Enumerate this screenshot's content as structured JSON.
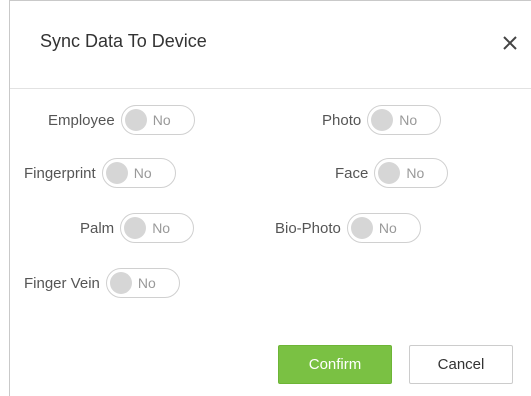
{
  "dialog": {
    "title": "Sync Data To Device",
    "close_icon": "close-icon"
  },
  "fields": {
    "employee": {
      "label": "Employee",
      "state": "No"
    },
    "photo": {
      "label": "Photo",
      "state": "No"
    },
    "fingerprint": {
      "label": "Fingerprint",
      "state": "No"
    },
    "face": {
      "label": "Face",
      "state": "No"
    },
    "palm": {
      "label": "Palm",
      "state": "No"
    },
    "bio_photo": {
      "label": "Bio-Photo",
      "state": "No"
    },
    "finger_vein": {
      "label": "Finger Vein",
      "state": "No"
    }
  },
  "buttons": {
    "confirm": "Confirm",
    "cancel": "Cancel"
  },
  "colors": {
    "confirm_bg": "#7ac143",
    "knob_off": "#d6d6d6"
  }
}
